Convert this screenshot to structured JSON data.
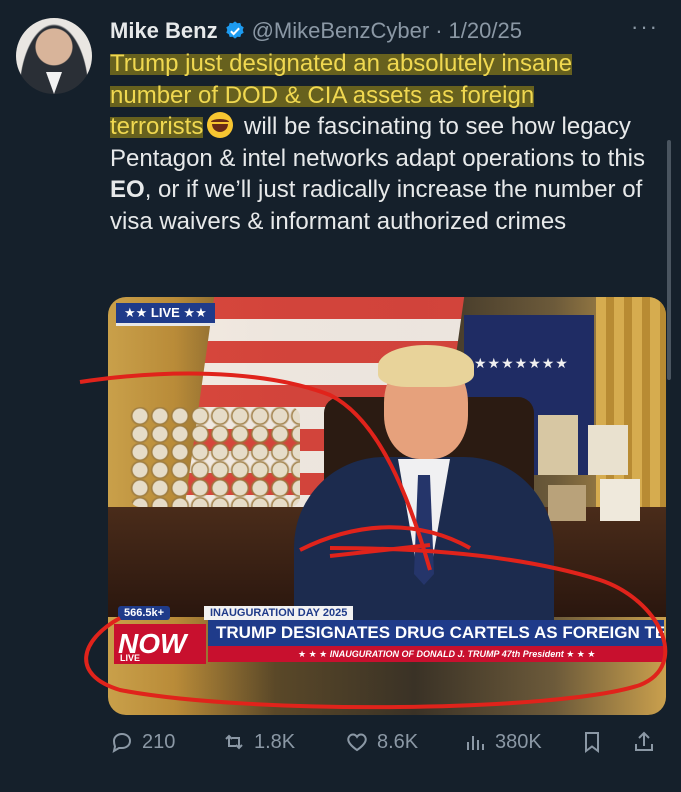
{
  "author": {
    "name": "Mike Benz",
    "handle": "@MikeBenzCyber",
    "date": "1/20/25"
  },
  "tweet": {
    "line_hl_1": "Trump just designated an absolutely insane",
    "line_hl_2": "number of DOD & CIA assets as foreign",
    "line_hl_3": "terrorists",
    "text_a": " will be fascinating to see how legacy Pentagon & intel networks adapt operations to this ",
    "text_bold": "EO",
    "text_b": ", or if we’ll just radically increase the number of visa waivers & informant authorized crimes"
  },
  "media": {
    "live_badge": "★★ LIVE ★★",
    "views": "566.5k+",
    "kicker": "INAUGURATION DAY 2025",
    "now_label": "NOW",
    "live_small": "LIVE",
    "headline": "TRUMP DESIGNATES DRUG CARTELS AS FOREIGN TERRORISTS",
    "subline": "★ ★ ★  INAUGURATION OF DONALD J. TRUMP  47th President  ★ ★ ★",
    "stars": "★★★★★★★"
  },
  "actions": {
    "replies": "210",
    "reposts": "1.8K",
    "likes": "8.6K",
    "views": "380K"
  },
  "colors": {
    "background": "#15202b",
    "highlight_text": "#f0d850",
    "muted": "#8b98a5",
    "verified": "#1d9bf0",
    "annotation_red": "#e0231b"
  }
}
